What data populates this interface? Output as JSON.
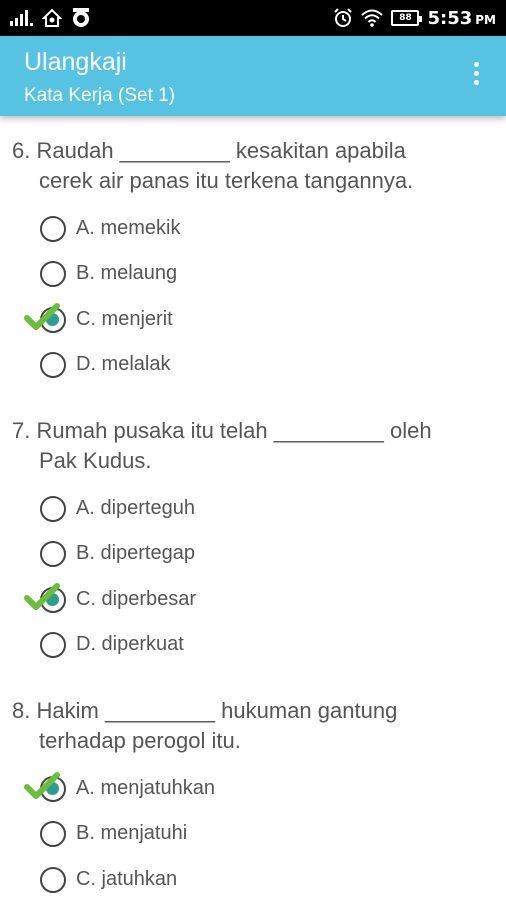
{
  "status": {
    "time": "5:53",
    "ampm": "PM",
    "battery": "88"
  },
  "header": {
    "title": "Ulangkaji",
    "subtitle": "Kata Kerja  (Set 1)"
  },
  "questions": [
    {
      "number": "6.",
      "line1": "Raudah _________ kesakitan apabila",
      "line2": "cerek air panas itu terkena tangannya.",
      "options": [
        {
          "label": "A. memekik",
          "selected": false
        },
        {
          "label": "B. melaung",
          "selected": false
        },
        {
          "label": "C. menjerit",
          "selected": true
        },
        {
          "label": "D. melalak",
          "selected": false
        }
      ]
    },
    {
      "number": "7.",
      "line1": "Rumah pusaka itu telah _________ oleh",
      "line2": "Pak Kudus.",
      "options": [
        {
          "label": "A. diperteguh",
          "selected": false
        },
        {
          "label": "B. dipertegap",
          "selected": false
        },
        {
          "label": "C. diperbesar",
          "selected": true
        },
        {
          "label": "D. diperkuat",
          "selected": false
        }
      ]
    },
    {
      "number": "8.",
      "line1": "Hakim _________ hukuman gantung",
      "line2": "terhadap perogol itu.",
      "options": [
        {
          "label": "A. menjatuhkan",
          "selected": true
        },
        {
          "label": "B. menjatuhi",
          "selected": false
        },
        {
          "label": "C. jatuhkan",
          "selected": false
        }
      ]
    }
  ],
  "colors": {
    "app_bar": "#56c3e3",
    "check": "#6abf3a",
    "radio_fill": "#2b9e8f"
  }
}
